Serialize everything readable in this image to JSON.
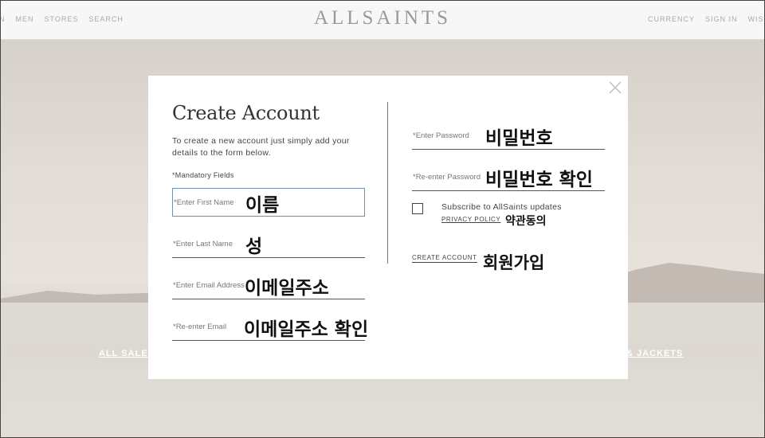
{
  "header": {
    "logo": "ALLSAINTS",
    "nav_left": [
      "EN",
      "MEN",
      "STORES",
      "SEARCH"
    ],
    "nav_right": [
      "CURRENCY",
      "SIGN IN",
      "WISH"
    ]
  },
  "hero": {
    "left_link": "ALL SALE",
    "right_link": "& JACKETS"
  },
  "modal": {
    "title": "Create Account",
    "intro": "To create a new account just simply add your details to the form below.",
    "mandatory": "*Mandatory Fields",
    "fields": {
      "first_name": {
        "placeholder": "*Enter First Name",
        "annotation": "이름"
      },
      "last_name": {
        "placeholder": "*Enter Last Name",
        "annotation": "성"
      },
      "email": {
        "placeholder": "*Enter Email Address",
        "annotation": "이메일주소"
      },
      "email_confirm": {
        "placeholder": "*Re-enter Email",
        "annotation": "이메일주소 확인"
      },
      "password": {
        "placeholder": "*Enter Password",
        "annotation": "비밀번호"
      },
      "password_confirm": {
        "placeholder": "*Re-enter Password",
        "annotation": "비밀번호 확인"
      }
    },
    "subscribe_label": "Subscribe to AllSaints updates",
    "privacy_link": "PRIVACY POLICY",
    "privacy_annotation": "약관동의",
    "create_button": "CREATE ACCOUNT",
    "create_annotation": "회원가입"
  }
}
